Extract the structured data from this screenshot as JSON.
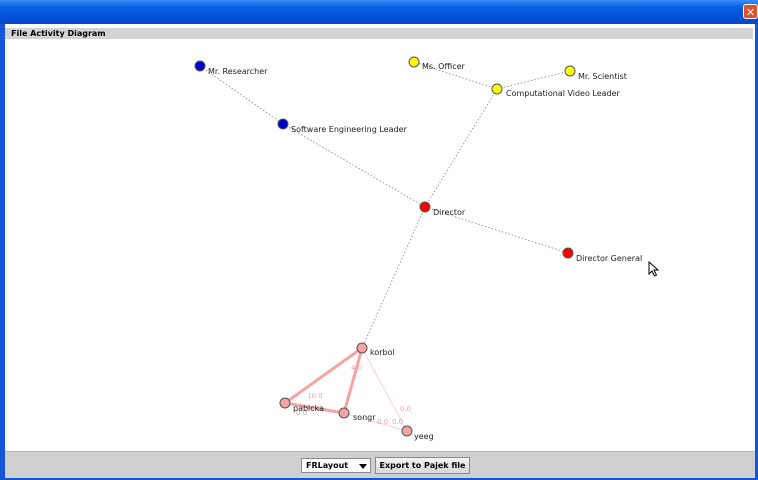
{
  "window": {
    "close_glyph": "✕"
  },
  "panel": {
    "title": "File Activity Diagram"
  },
  "graph": {
    "nodes": [
      {
        "id": "mr-researcher",
        "label": "Mr. Researcher",
        "color": "#0000cc"
      },
      {
        "id": "ms-officer",
        "label": "Ms. Officer",
        "color": "#ffff00"
      },
      {
        "id": "mr-scientist",
        "label": "Mr. Scientist",
        "color": "#ffff00"
      },
      {
        "id": "cv-leader",
        "label": "Computational Video Leader",
        "color": "#ffff00"
      },
      {
        "id": "se-leader",
        "label": "Software Engineering Leader",
        "color": "#0000cc"
      },
      {
        "id": "director",
        "label": "Director",
        "color": "#ff0000"
      },
      {
        "id": "director-general",
        "label": "Director General",
        "color": "#ff0000"
      },
      {
        "id": "korbol",
        "label": "korbol",
        "color": "#f4a4a4"
      },
      {
        "id": "pabicka",
        "label": "pabicka",
        "color": "#f4a4a4"
      },
      {
        "id": "songr",
        "label": "songr",
        "color": "#f4a4a4"
      },
      {
        "id": "yeeg",
        "label": "yeeg",
        "color": "#f4a4a4"
      }
    ],
    "edge_labels": [
      "4.0",
      "10.0",
      "0.0",
      "0.0",
      "0.0",
      "0.0"
    ]
  },
  "controls": {
    "layout_value": "FRLayout",
    "export_label": "Export to Pajek file"
  }
}
